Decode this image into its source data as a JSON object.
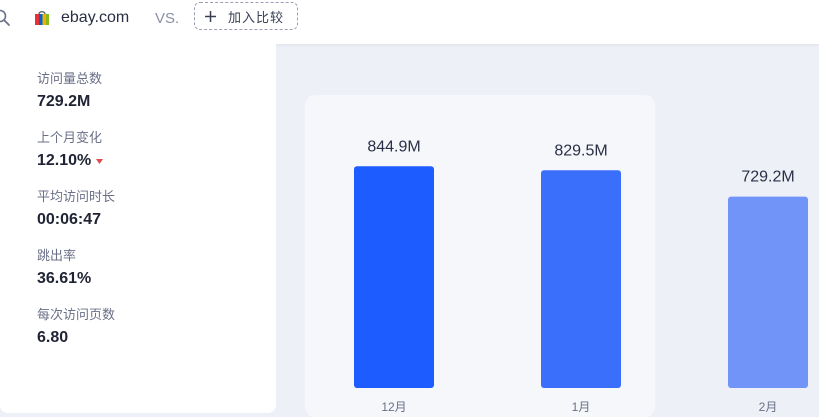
{
  "header": {
    "site_name": "ebay.com",
    "vs_label": "VS.",
    "compare_button_label": "加入比较",
    "icons": {
      "search": "search-icon",
      "site": "ebay-bag-icon",
      "compare": "plus-icon"
    }
  },
  "stats": [
    {
      "label": "访问量总数",
      "value": "729.2M"
    },
    {
      "label": "上个月变化",
      "value": "12.10%",
      "trend": "down",
      "trend_color": "#e5484d"
    },
    {
      "label": "平均访问时长",
      "value": "00:06:47"
    },
    {
      "label": "跳出率",
      "value": "36.61%"
    },
    {
      "label": "每次访问页数",
      "value": "6.80"
    }
  ],
  "chart_data": {
    "type": "bar",
    "categories": [
      "12月",
      "1月",
      "2月"
    ],
    "values": [
      844.9,
      829.5,
      729.2
    ],
    "data_labels": [
      "844.9M",
      "829.5M",
      "729.2M"
    ],
    "colors": [
      "#1d5cff",
      "#3a6ffc",
      "#7094f8"
    ],
    "ylim": [
      0,
      1105
    ],
    "grid": false,
    "title": "",
    "xlabel": "",
    "ylabel": ""
  }
}
